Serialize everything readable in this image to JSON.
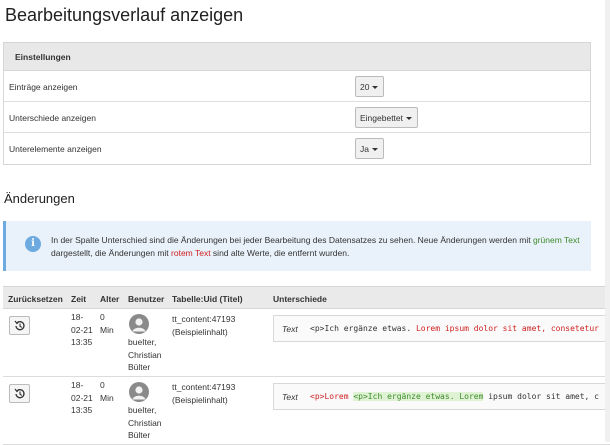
{
  "page_title": "Bearbeitungsverlauf anzeigen",
  "settings": {
    "header": "Einstellungen",
    "rows": [
      {
        "label": "Einträge anzeigen",
        "value": "20"
      },
      {
        "label": "Unterschiede anzeigen",
        "value": "Eingebettet"
      },
      {
        "label": "Unterelemente anzeigen",
        "value": "Ja"
      }
    ]
  },
  "changes": {
    "title": "Änderungen",
    "info": {
      "part1": "In der Spalte Unterschied sind die Änderungen bei jeder Bearbeitung des Datensatzes zu sehen. Neue Änderungen werden mit ",
      "green_text": "grünem Text",
      "part2": " dargestellt, die Änderungen mit ",
      "red_text": "rotem Text",
      "part3": " sind alte Werte, die entfernt wurden."
    },
    "colors": {
      "new": "#3d8a2a",
      "old": "#cf1f1f",
      "info_accent": "#6daae0"
    }
  },
  "table": {
    "headers": [
      "Zurücksetzen",
      "Zeit",
      "Alter",
      "Benutzer",
      "Tabelle:Uid (Titel)",
      "Unterschiede"
    ],
    "rows": [
      {
        "time": [
          "18-",
          "02-21",
          "13:35"
        ],
        "age": [
          "0",
          "Min"
        ],
        "user": [
          "bueIter,",
          "Christian",
          "Bülter"
        ],
        "record": [
          "tt_content:47193",
          "(Beispielinhalt)"
        ],
        "diff_label": "Text",
        "diff_plain1": "<p>Ich ergänze etwas. ",
        "diff_del": "Lorem ipsum dolor sit amet, consetetur",
        "diff_ins": "",
        "diff_plain2": ""
      },
      {
        "time": [
          "18-",
          "02-21",
          "13:35"
        ],
        "age": [
          "0",
          "Min"
        ],
        "user": [
          "bueIter,",
          "Christian",
          "Bülter"
        ],
        "record": [
          "tt_content:47193",
          "(Beispielinhalt)"
        ],
        "diff_label": "Text",
        "diff_plain1": "",
        "diff_del": "<p>Lorem ",
        "diff_ins": "<p>Ich ergänze etwas. Lorem",
        "diff_plain2": " ipsum dolor sit amet, c"
      }
    ]
  },
  "icons": {
    "revert": "history-revert-icon",
    "user": "user-avatar-icon",
    "info": "info-icon"
  }
}
